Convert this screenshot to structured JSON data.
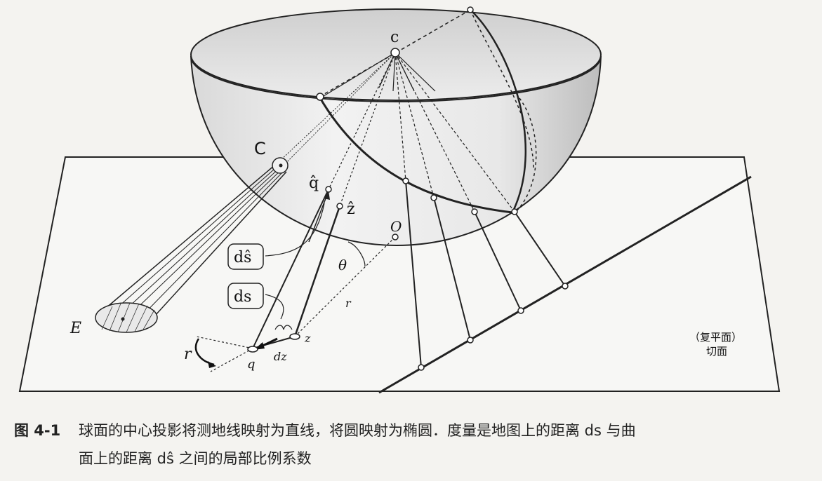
{
  "labels": {
    "c": "c",
    "C": "C",
    "E": "E",
    "O": "O",
    "q_hat": "q̂",
    "z_hat": "ẑ",
    "q": "q",
    "z": "z",
    "dz": "dz",
    "theta": "θ",
    "r": "r",
    "r_rot": "r",
    "ds_hat": "dŝ",
    "ds": "ds",
    "plane_label_1": "（复平面）",
    "plane_label_2": "切面"
  },
  "caption": {
    "number": "图 4-1",
    "line1": "球面的中心投影将测地线映射为直线，将圆映射为椭圆．度量是地图上的距离 ds 与曲",
    "line2": "面上的距离 dŝ 之间的局部比例系数"
  }
}
